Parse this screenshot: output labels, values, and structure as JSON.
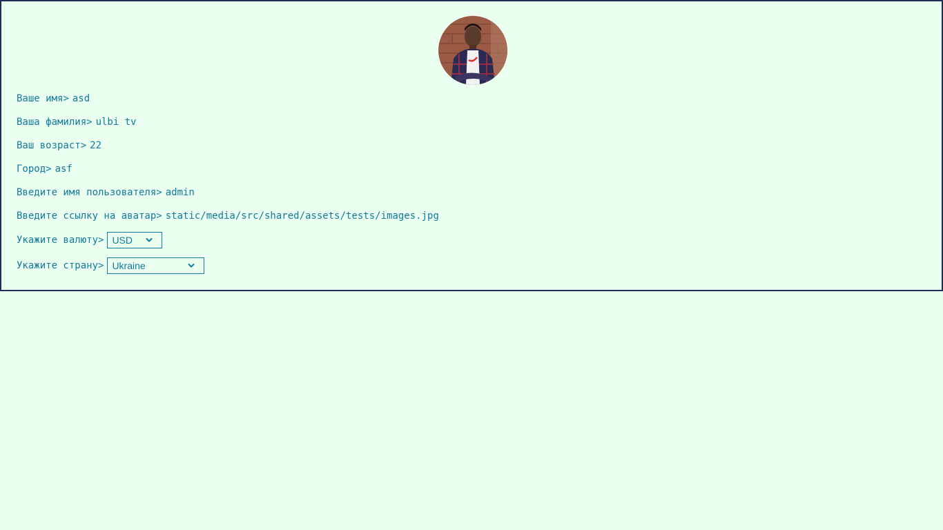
{
  "profile": {
    "avatar_alt": "avatar",
    "fields": {
      "first_name": {
        "label": "Ваше имя>",
        "value": "asd"
      },
      "last_name": {
        "label": "Ваша фамилия>",
        "value": "ulbi tv"
      },
      "age": {
        "label": "Ваш возраст>",
        "value": "22"
      },
      "city": {
        "label": "Город>",
        "value": "asf"
      },
      "username": {
        "label": "Введите имя пользователя>",
        "value": "admin"
      },
      "avatar_link": {
        "label": "Введите ссылку на аватар>",
        "value": "static/media/src/shared/assets/tests/images.jpg"
      }
    },
    "currency": {
      "label": "Укажите валюту>",
      "selected": "USD"
    },
    "country": {
      "label": "Укажите страну>",
      "selected": "Ukraine"
    }
  },
  "colors": {
    "background": "#ebfff1",
    "text": "#137a9c",
    "border": "#1f2f5a"
  }
}
